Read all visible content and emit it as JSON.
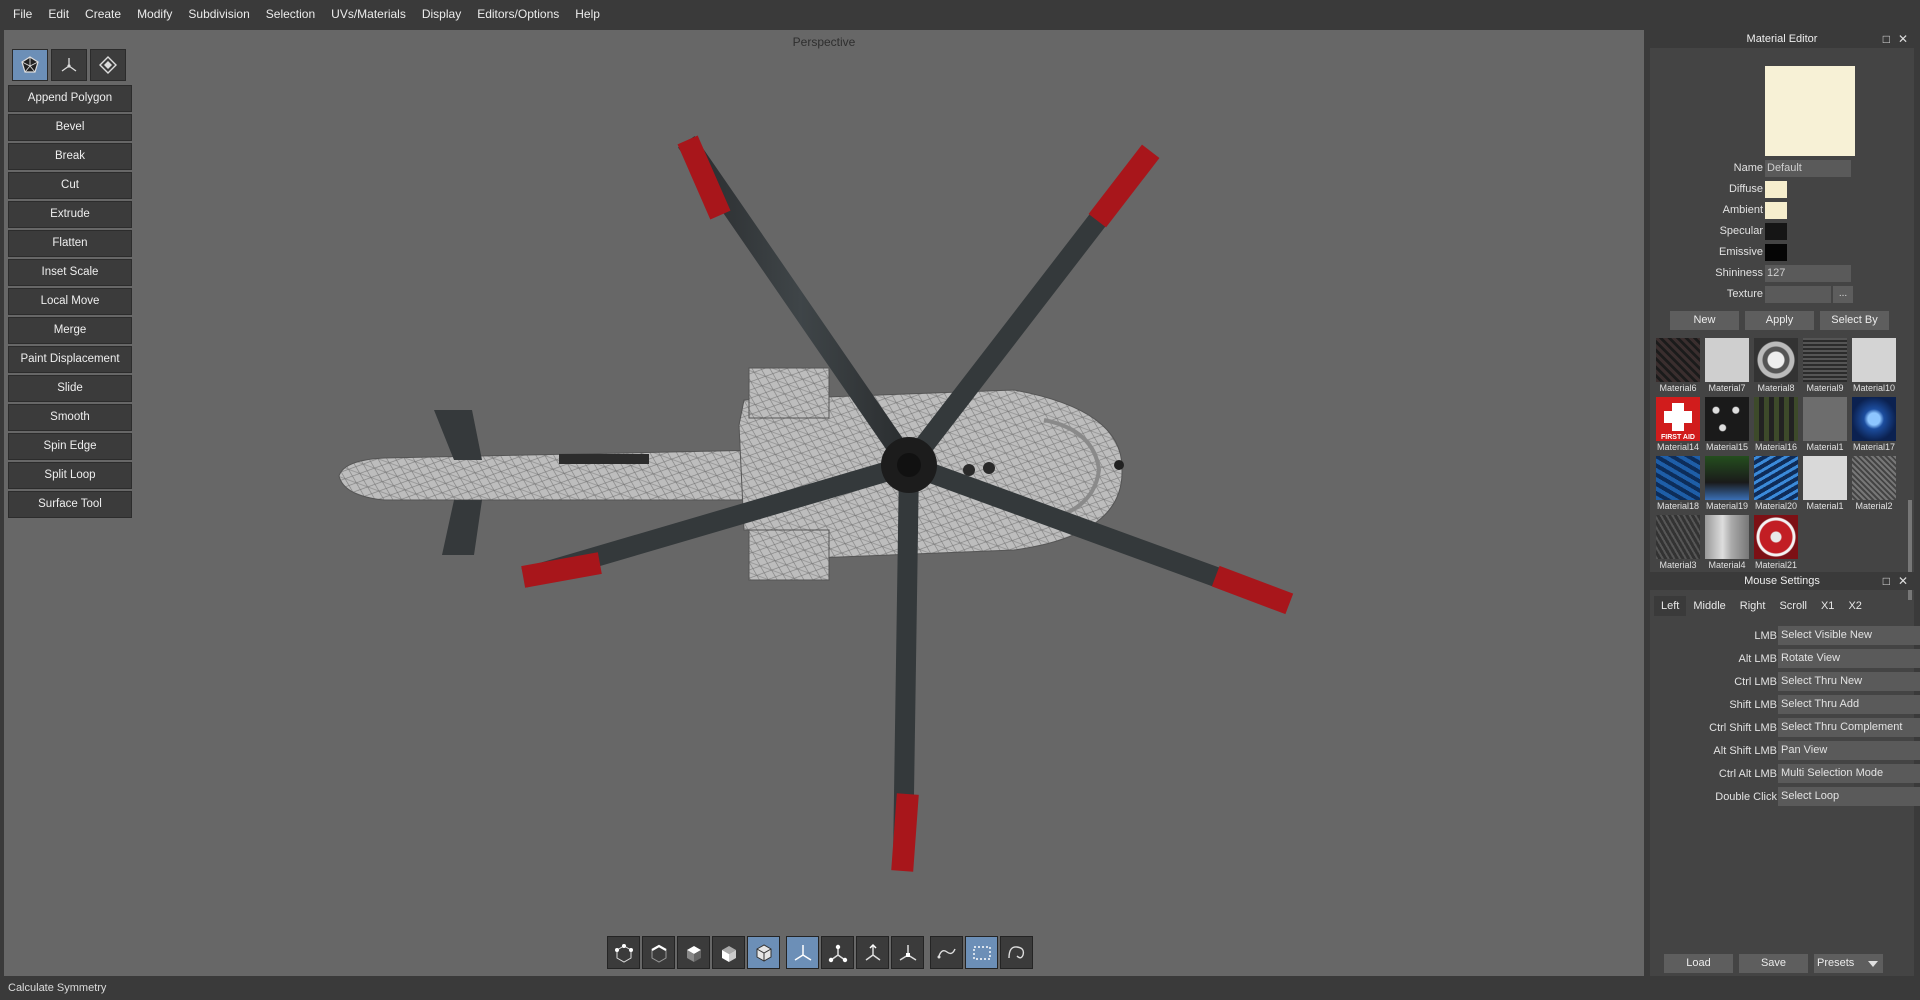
{
  "menu": [
    "File",
    "Edit",
    "Create",
    "Modify",
    "Subdivision",
    "Selection",
    "UVs/Materials",
    "Display",
    "Editors/Options",
    "Help"
  ],
  "viewport": {
    "label": "Perspective"
  },
  "tools": [
    "Append Polygon",
    "Bevel",
    "Break",
    "Cut",
    "Extrude",
    "Flatten",
    "Inset Scale",
    "Local Move",
    "Merge",
    "Paint Displacement",
    "Slide",
    "Smooth",
    "Spin Edge",
    "Split Loop",
    "Surface Tool"
  ],
  "status": "Calculate Symmetry",
  "material_editor": {
    "title": "Material Editor",
    "name_label": "Name",
    "name_value": "Default",
    "diffuse_label": "Diffuse",
    "ambient_label": "Ambient",
    "specular_label": "Specular",
    "emissive_label": "Emissive",
    "shininess_label": "Shininess",
    "shininess_value": "127",
    "texture_label": "Texture",
    "texture_button": "...",
    "new_button": "New",
    "apply_button": "Apply",
    "selectby_button": "Select By",
    "colors": {
      "diffuse": "#f6eecd",
      "ambient": "#f6eecd",
      "specular": "#151515",
      "emissive": "#050505"
    },
    "materials": [
      "Material6",
      "Material7",
      "Material8",
      "Material9",
      "Material10",
      "Material14",
      "Material15",
      "Material16",
      "Material1",
      "Material17",
      "Material18",
      "Material19",
      "Material20",
      "Material1",
      "Material2",
      "Material3",
      "Material4",
      "Material21"
    ],
    "first_aid_text": "FIRST AID"
  },
  "mouse_settings": {
    "title": "Mouse Settings",
    "tabs": [
      "Left",
      "Middle",
      "Right",
      "Scroll",
      "X1",
      "X2"
    ],
    "rows": [
      {
        "label": "LMB",
        "value": "Select Visible New"
      },
      {
        "label": "Alt LMB",
        "value": "Rotate View"
      },
      {
        "label": "Ctrl LMB",
        "value": "Select Thru New"
      },
      {
        "label": "Shift LMB",
        "value": "Select Thru Add"
      },
      {
        "label": "Ctrl Shift LMB",
        "value": "Select Thru Complement"
      },
      {
        "label": "Alt Shift LMB",
        "value": "Pan View"
      },
      {
        "label": "Ctrl Alt LMB",
        "value": "Multi Selection Mode"
      },
      {
        "label": "Double Click",
        "value": "Select Loop"
      }
    ],
    "load_button": "Load",
    "save_button": "Save",
    "presets_button": "Presets"
  }
}
